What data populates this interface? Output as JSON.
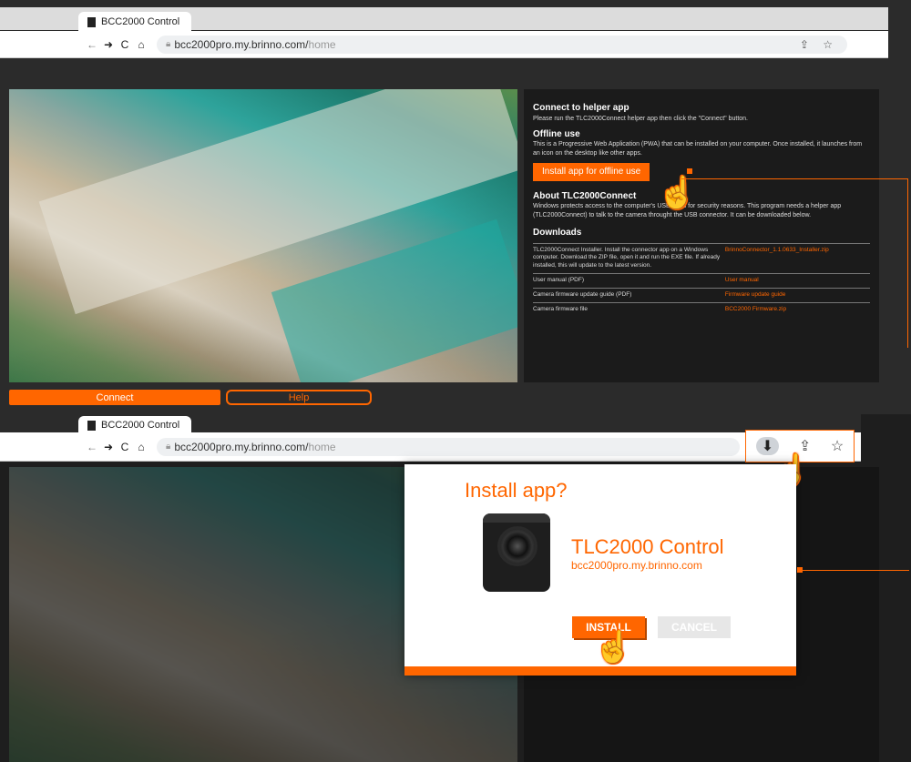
{
  "browser_top": {
    "tab_title": "BCC2000 Control",
    "nav": {
      "back": "←",
      "forward": "➜",
      "reload": "C",
      "home": "⌂"
    },
    "url_host": "bcc2000pro.my.brinno.com/",
    "url_path": "home",
    "omni_actions": "⇪ ☆"
  },
  "helper": {
    "heading": "Connect to helper app",
    "text": "Please run the TLC2000Connect helper app then click the \"Connect\" button."
  },
  "offline": {
    "heading": "Offline use",
    "text": "This is a Progressive Web Application (PWA) that can be installed on your computer. Once installed, it launches from an icon on the desktop like other apps.",
    "button": "Install app for offline use"
  },
  "about": {
    "heading": "About TLC2000Connect",
    "text": "Windows protects access to the computer's USB ports for security reasons. This program needs a helper app (TLC2000Connect) to talk to the camera throught the USB connector. It can be downloaded below."
  },
  "downloads": {
    "heading": "Downloads",
    "rows": [
      {
        "label": "TLC2000Connect Installer. Install the connector app on a Windows computer. Download the ZIP file, open it and run the EXE file. If already installed, this will update to the latest version.",
        "link": "BrinnoConnector_1.1.0633_Installer.zip"
      },
      {
        "label": "User manual (PDF)",
        "link": "User manual"
      },
      {
        "label": "Camera firmware update guide (PDF)",
        "link": "Firmware update guide"
      },
      {
        "label": "Camera firmware file",
        "link": "BCC2000 Firmware.zip"
      }
    ]
  },
  "buttons": {
    "connect": "Connect",
    "help": "Help"
  },
  "browser_bottom": {
    "tab_title": "BCC2000 Control",
    "url_host": "bcc2000pro.my.brinno.com/",
    "url_path": "home",
    "icons": {
      "install": "⬇",
      "share": "⇪",
      "star": "☆"
    }
  },
  "dialog": {
    "title": "Install app?",
    "app_name": "TLC2000 Control",
    "app_url": "bcc2000pro.my.brinno.com",
    "install": "INSTALL",
    "cancel": "CANCEL"
  },
  "colors": {
    "accent": "#ff6600",
    "panel": "#1b1b1b",
    "page": "#2b2b2b"
  }
}
